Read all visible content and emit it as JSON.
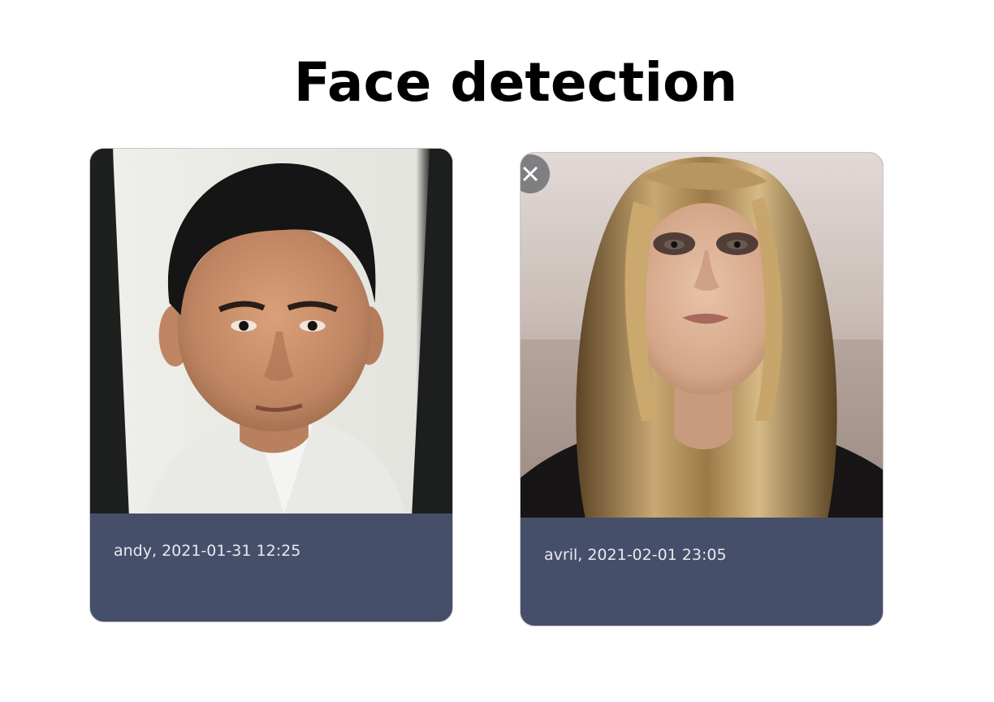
{
  "page": {
    "title": "Face detection"
  },
  "cards": [
    {
      "caption": "andy, 2021-01-31 12:25",
      "image_icon": "portrait-photo-icon"
    },
    {
      "caption": "avril, 2021-02-01 23:05",
      "image_icon": "portrait-photo-icon",
      "close_icon": "close-icon"
    }
  ],
  "colors": {
    "card_footer": "#464f6a",
    "caption_text": "#e8e9ef",
    "title_text": "#000000"
  }
}
